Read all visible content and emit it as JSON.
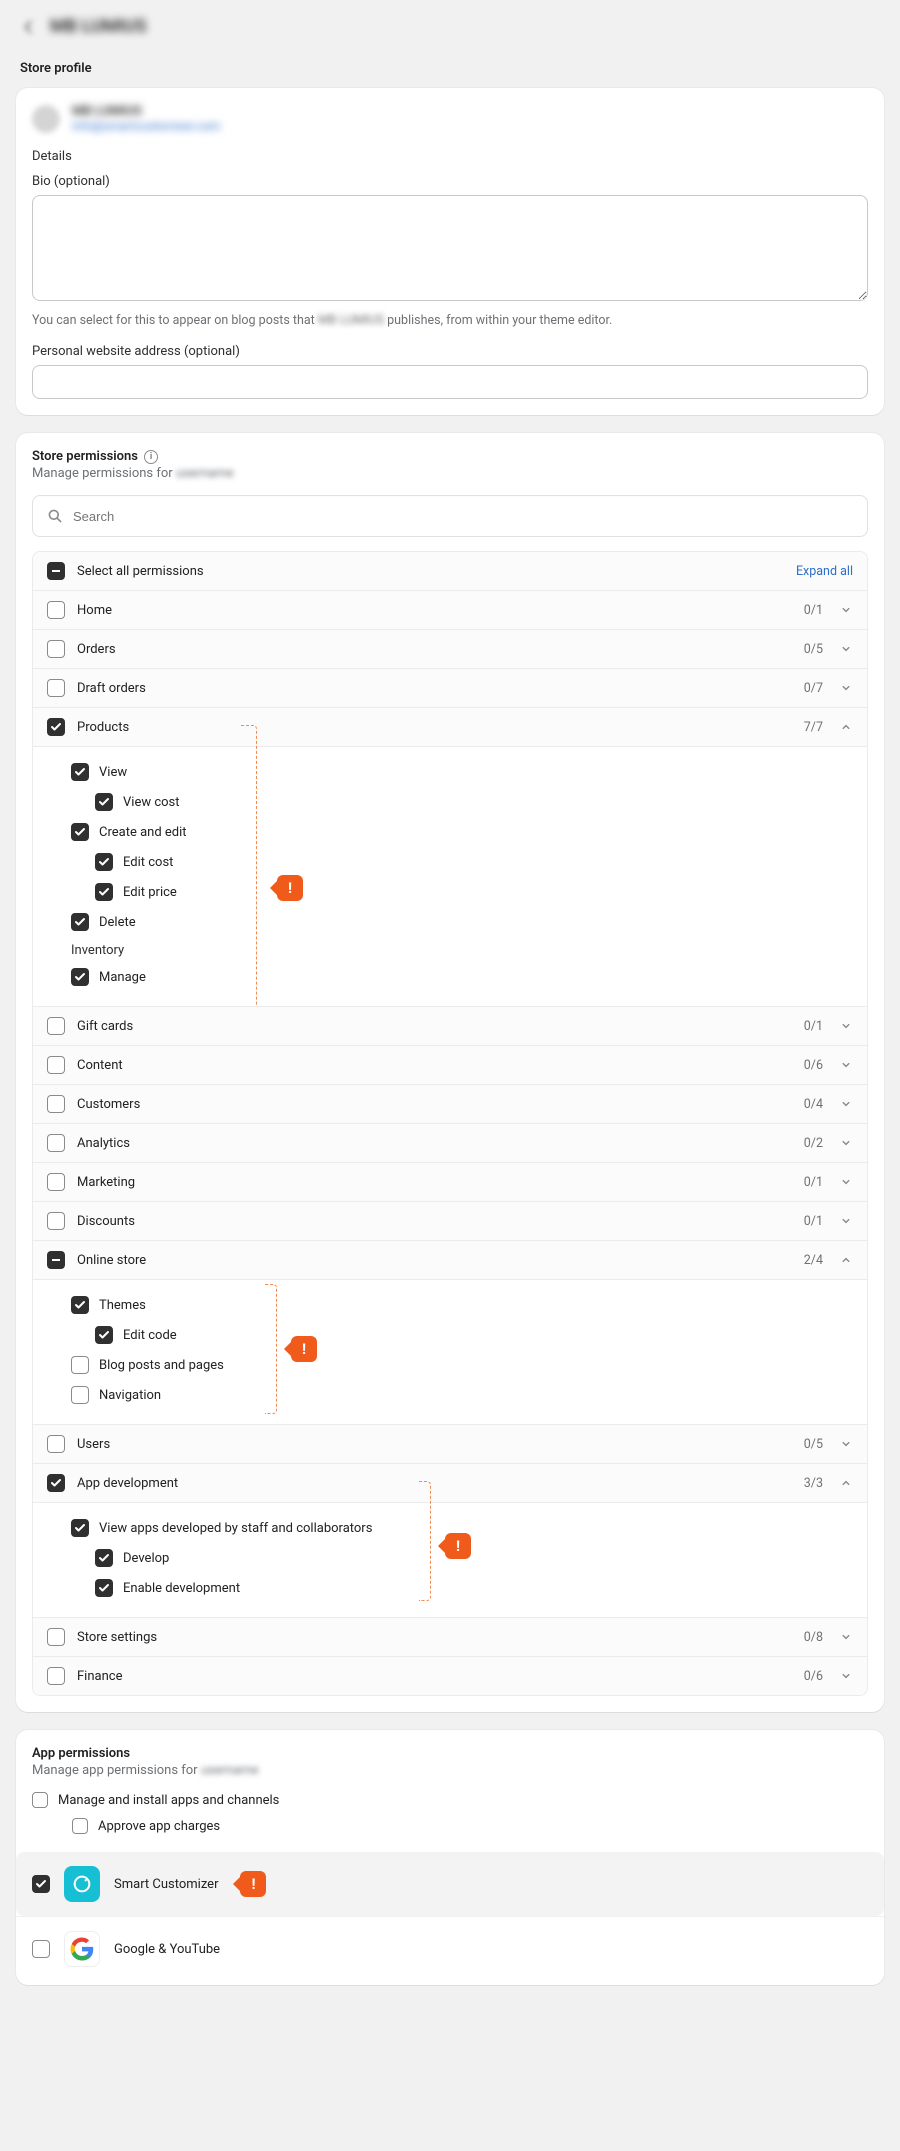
{
  "page": {
    "back_title": "MB LUMIUS",
    "section_heading": "Store profile"
  },
  "profile": {
    "name": "MB LUMIUS",
    "email": "info@smartcustomizer.com",
    "details_heading": "Details",
    "bio_label": "Bio (optional)",
    "bio_help_pre": "You can select for this to appear on blog posts that ",
    "bio_help_blur": "MB LUMIUS",
    "bio_help_post": " publishes, from within your theme editor.",
    "website_label": "Personal website address (optional)"
  },
  "store_perm": {
    "title": "Store permissions",
    "sub_pre": "Manage permissions for ",
    "sub_blur": "username",
    "search_placeholder": "Search",
    "select_all": "Select all permissions",
    "expand_all": "Expand all",
    "rows": {
      "home": {
        "label": "Home",
        "count": "0/1"
      },
      "orders": {
        "label": "Orders",
        "count": "0/5"
      },
      "draft": {
        "label": "Draft orders",
        "count": "0/7"
      },
      "products": {
        "label": "Products",
        "count": "7/7"
      },
      "gift": {
        "label": "Gift cards",
        "count": "0/1"
      },
      "content": {
        "label": "Content",
        "count": "0/6"
      },
      "customers": {
        "label": "Customers",
        "count": "0/4"
      },
      "analytics": {
        "label": "Analytics",
        "count": "0/2"
      },
      "marketing": {
        "label": "Marketing",
        "count": "0/1"
      },
      "discounts": {
        "label": "Discounts",
        "count": "0/1"
      },
      "online": {
        "label": "Online store",
        "count": "2/4"
      },
      "users": {
        "label": "Users",
        "count": "0/5"
      },
      "appdev": {
        "label": "App development",
        "count": "3/3"
      },
      "settings": {
        "label": "Store settings",
        "count": "0/8"
      },
      "finance": {
        "label": "Finance",
        "count": "0/6"
      }
    },
    "products_sub": {
      "view": "View",
      "view_cost": "View cost",
      "create": "Create and edit",
      "edit_cost": "Edit cost",
      "edit_price": "Edit price",
      "delete": "Delete",
      "inventory_h": "Inventory",
      "manage": "Manage"
    },
    "online_sub": {
      "themes": "Themes",
      "edit_code": "Edit code",
      "blog": "Blog posts and pages",
      "nav": "Navigation"
    },
    "appdev_sub": {
      "view": "View apps developed by staff and collaborators",
      "develop": "Develop",
      "enable": "Enable development"
    }
  },
  "app_perm": {
    "title": "App permissions",
    "sub_pre": "Manage app permissions for ",
    "sub_blur": "username",
    "manage_install": "Manage and install apps and channels",
    "approve": "Approve app charges",
    "apps": {
      "smart": "Smart Customizer",
      "google": "Google & YouTube"
    }
  },
  "callout": "!"
}
